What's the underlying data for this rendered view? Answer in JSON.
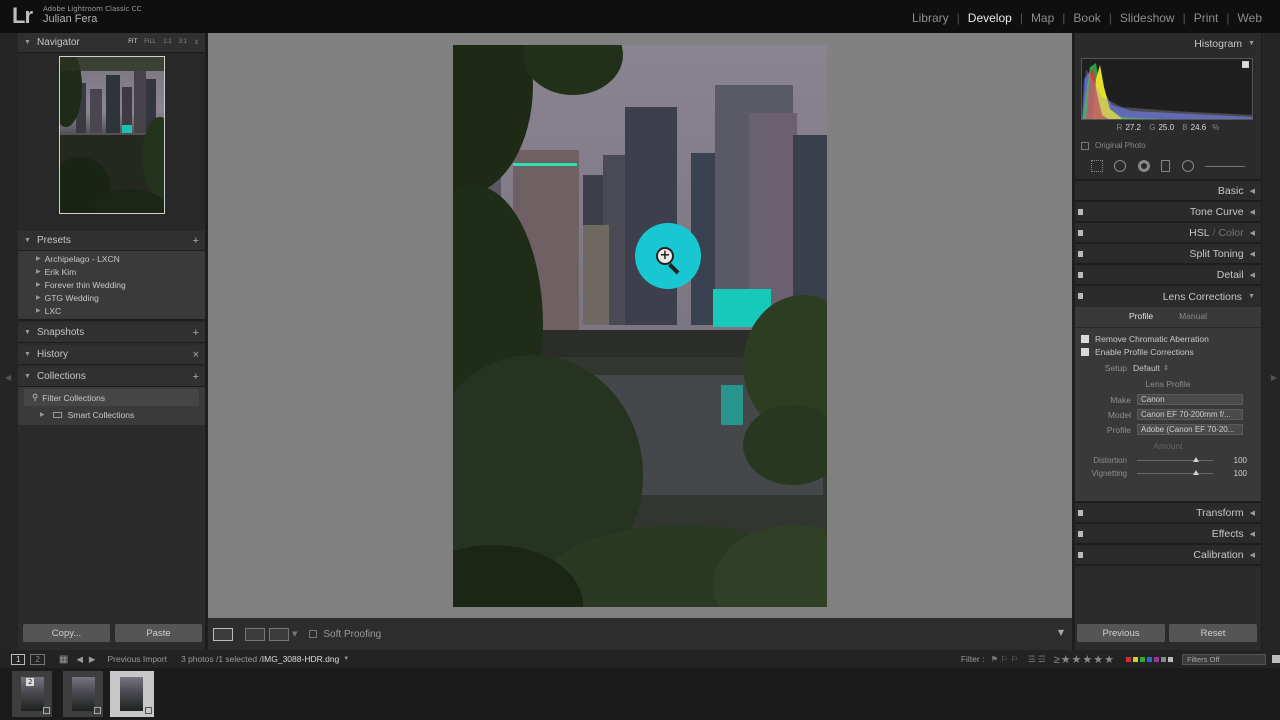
{
  "app": {
    "logo": "Lr",
    "name": "Adobe Lightroom Classic CC",
    "user": "Julian Fera"
  },
  "modules": [
    {
      "label": "Library",
      "active": false
    },
    {
      "label": "Develop",
      "active": true
    },
    {
      "label": "Map",
      "active": false
    },
    {
      "label": "Book",
      "active": false
    },
    {
      "label": "Slideshow",
      "active": false
    },
    {
      "label": "Print",
      "active": false
    },
    {
      "label": "Web",
      "active": false
    }
  ],
  "left": {
    "navigator": {
      "title": "Navigator",
      "zoom": [
        "FIT",
        "FILL",
        "1:1",
        "3:1"
      ]
    },
    "presets": {
      "title": "Presets",
      "items": [
        "Archipelago - LXCN",
        "Erik Kim",
        "Forever thin Wedding",
        "GTG Wedding",
        "LXC"
      ]
    },
    "snapshots": {
      "title": "Snapshots"
    },
    "history": {
      "title": "History"
    },
    "collections": {
      "title": "Collections",
      "filter": "Filter Collections",
      "smart": "Smart Collections"
    },
    "copy": "Copy...",
    "paste": "Paste"
  },
  "toolbar": {
    "soft_proofing": "Soft Proofing"
  },
  "right": {
    "histogram": {
      "title": "Histogram",
      "r_label": "R",
      "r": "27.2",
      "g_label": "G",
      "g": "25.0",
      "b_label": "B",
      "b": "24.6",
      "unit": "%",
      "original": "Original Photo"
    },
    "sections": {
      "basic": "Basic",
      "tone_curve": "Tone Curve",
      "hsl": "HSL",
      "color": "Color",
      "split": "Split Toning",
      "detail": "Detail",
      "lens": "Lens Corrections",
      "transform": "Transform",
      "effects": "Effects",
      "calibration": "Calibration"
    },
    "lens": {
      "tab_profile": "Profile",
      "tab_manual": "Manual",
      "remove_ca": "Remove Chromatic Aberration",
      "enable_profile": "Enable Profile Corrections",
      "setup_label": "Setup",
      "setup_value": "Default",
      "lens_profile": "Lens Profile",
      "make_label": "Make",
      "make": "Canon",
      "model_label": "Model",
      "model": "Canon EF 70-200mm f/...",
      "profile_label": "Profile",
      "profile": "Adobe (Canon EF 70-20...",
      "amount": "Amount",
      "distortion_label": "Distortion",
      "distortion": "100",
      "vignetting_label": "Vignetting",
      "vignetting": "100"
    },
    "previous": "Previous",
    "reset": "Reset"
  },
  "filmstrip": {
    "page1": "1",
    "page2": "2",
    "source": "Previous Import",
    "count": "3 photos /1 selected /",
    "filename": "IMG_3088-HDR.dng",
    "filter_label": "Filter :",
    "filters_off": "Filters Off",
    "stack_badge": "2"
  },
  "icons": {
    "zoom": "zoom-in-cursor-icon",
    "panel_close": "x-icon",
    "panel_add": "plus-icon"
  },
  "colors": {
    "accent_cursor": "#19c7d2"
  }
}
